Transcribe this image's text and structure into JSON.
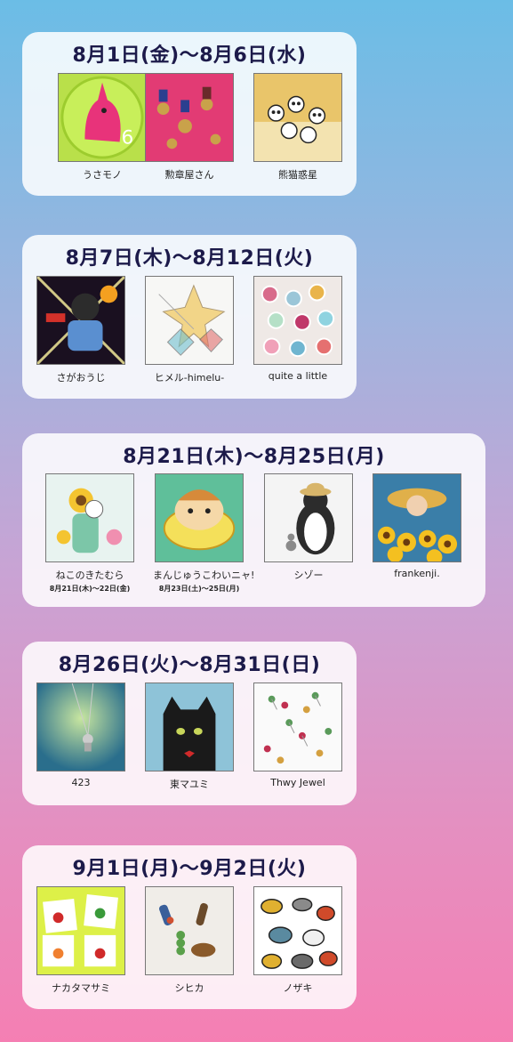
{
  "sections": [
    {
      "date": "8月1日(金)〜8月6日(水)",
      "artists": [
        {
          "name": "うさモノ",
          "image": "rabbit-clock-image"
        },
        {
          "name": "勲章屋さん",
          "image": "medals-image"
        },
        {
          "name": "熊猫惑星",
          "image": "pandas-image"
        }
      ]
    },
    {
      "date": "8月7日(木)〜8月12日(火)",
      "artists": [
        {
          "name": "さがおうじ",
          "image": "cat-illustration-image"
        },
        {
          "name": "ヒメル-himelu-",
          "image": "star-earrings-image"
        },
        {
          "name": "quite a little",
          "image": "embroidery-buttons-image"
        }
      ]
    },
    {
      "date": "8月21日(木)〜8月25日(月)",
      "artists": [
        {
          "name": "ねこのきたむら",
          "sub": "8月21日(木)〜22日(金)",
          "image": "cat-sunflower-illustration-image"
        },
        {
          "name": "まんじゅうこわいニャ!",
          "sub": "8月23日(土)〜25日(月)",
          "image": "hamster-illustration-image"
        },
        {
          "name": "シゾー",
          "image": "penguin-figure-image"
        },
        {
          "name": "frankenji.",
          "image": "sunflower-girl-image"
        }
      ]
    },
    {
      "date": "8月26日(火)〜8月31日(日)",
      "artists": [
        {
          "name": "423",
          "image": "pendant-image"
        },
        {
          "name": "東マユミ",
          "image": "black-cat-image"
        },
        {
          "name": "Thwy Jewel",
          "image": "jewelry-pins-image"
        }
      ]
    },
    {
      "date": "9月1日(月)〜9月2日(火)",
      "artists": [
        {
          "name": "ナカタマサミ",
          "image": "fruit-pins-image"
        },
        {
          "name": "シヒカ",
          "image": "food-accessories-image"
        },
        {
          "name": "ノザキ",
          "image": "bug-illustration-image"
        }
      ]
    }
  ]
}
